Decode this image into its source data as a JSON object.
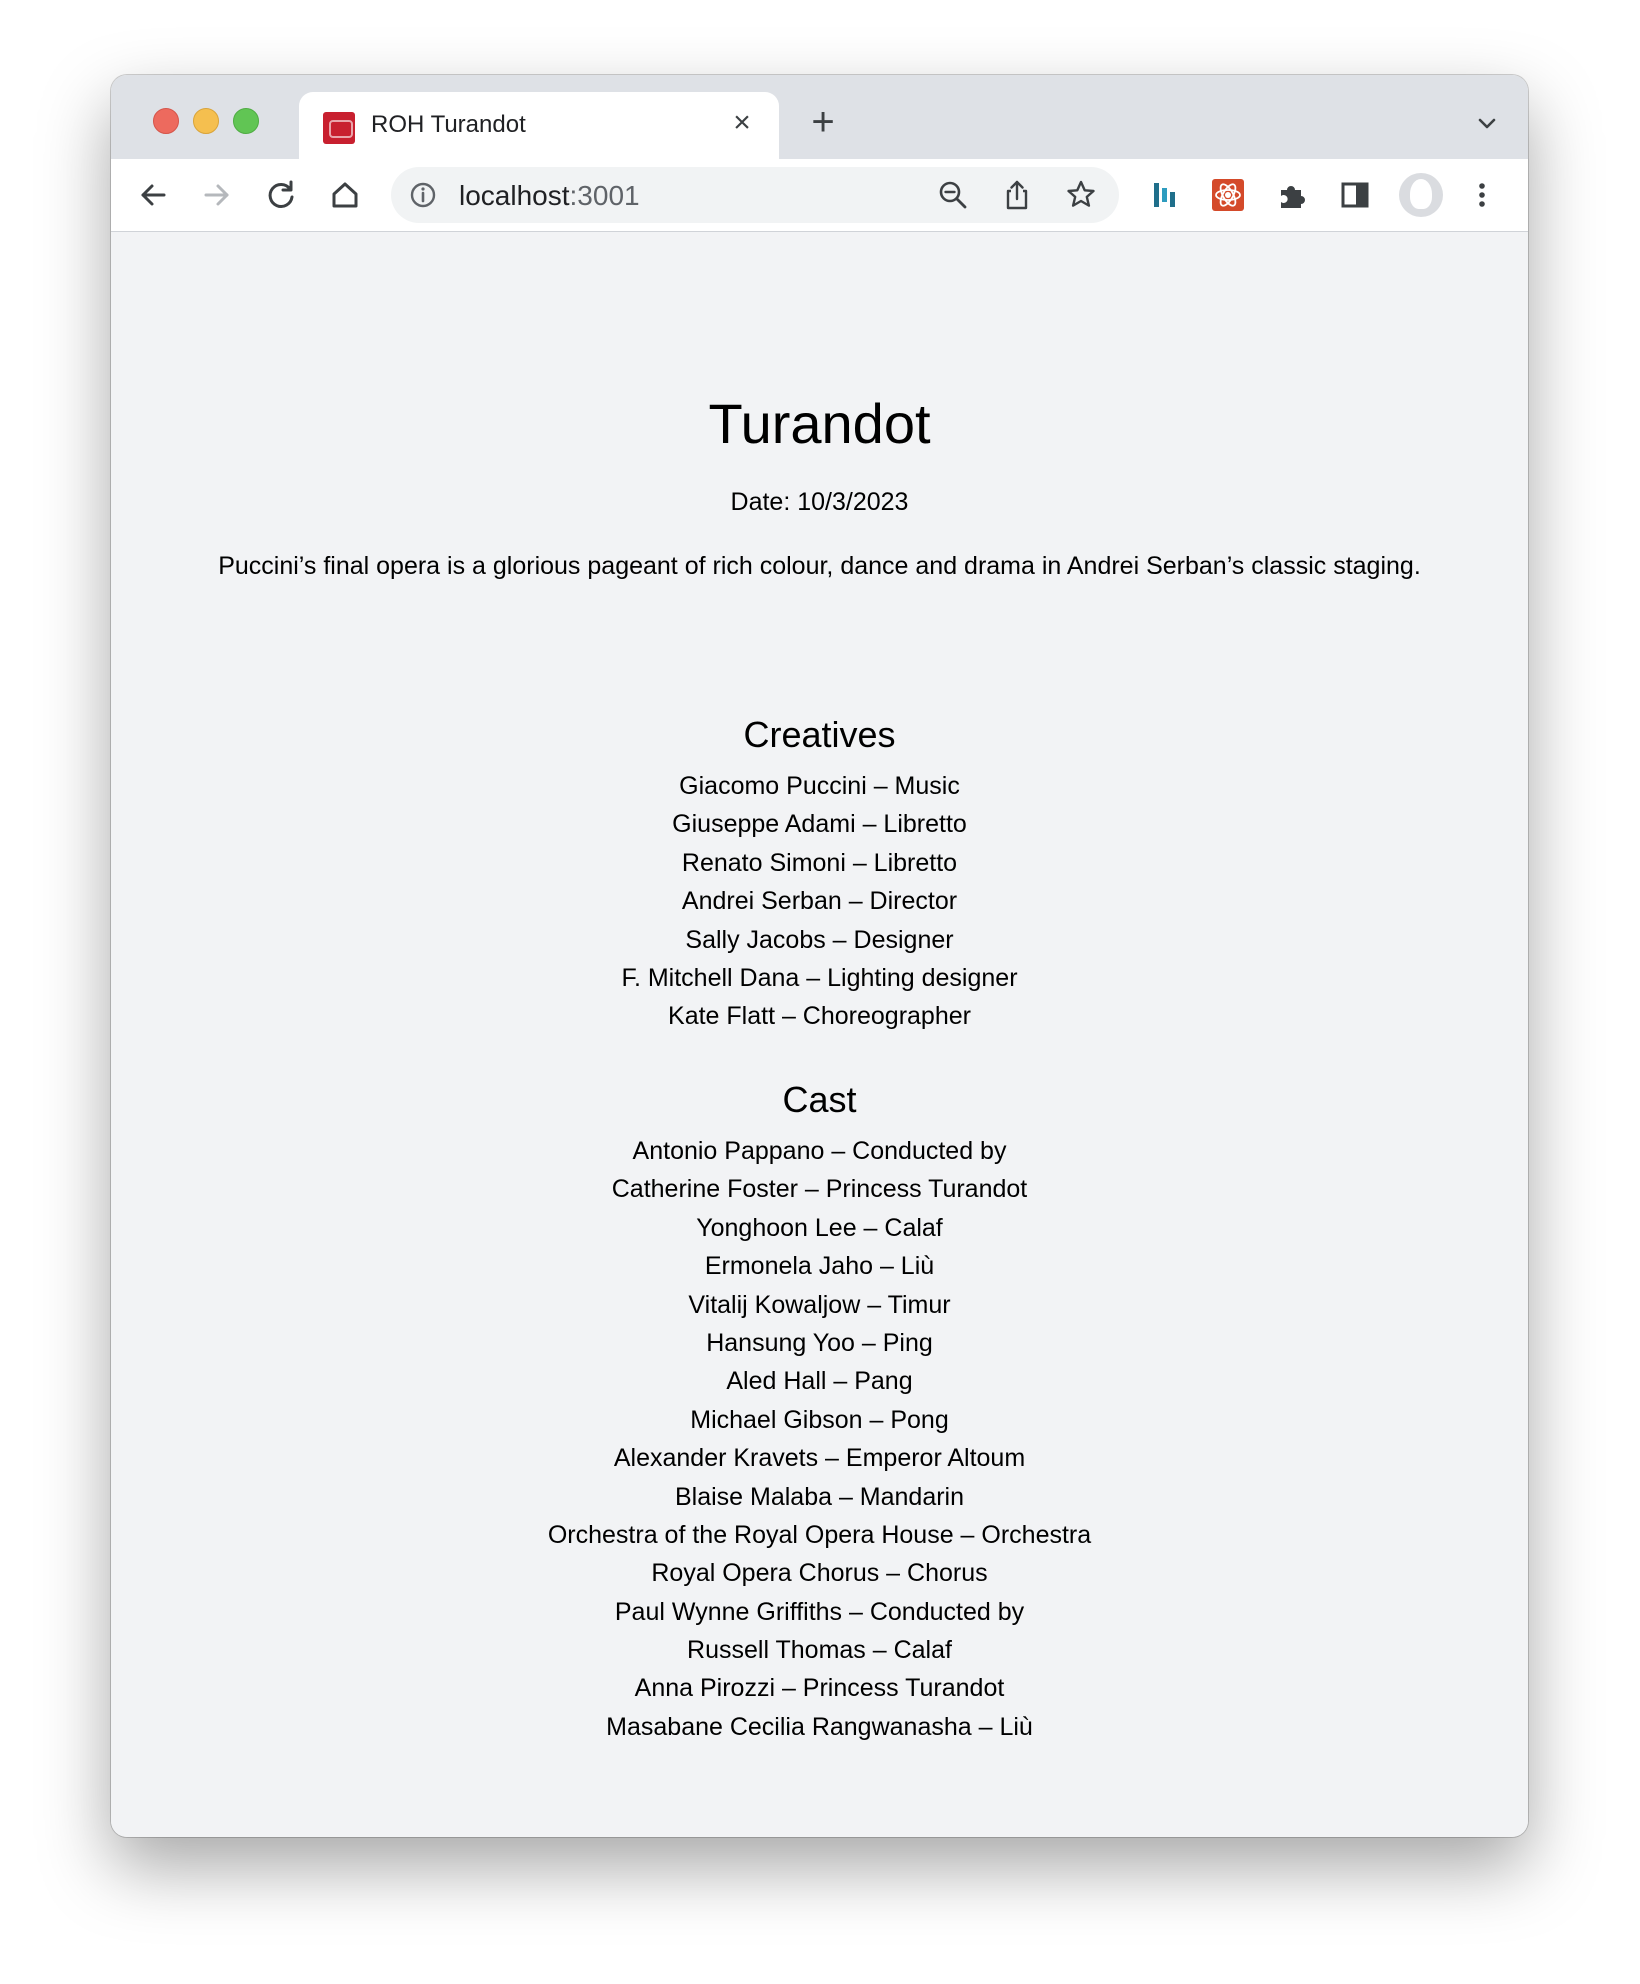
{
  "browser": {
    "tab": {
      "title": "ROH Turandot",
      "favicon": "roh-logo-icon",
      "close_label": "×"
    },
    "new_tab_label": "+",
    "address": {
      "host": "localhost",
      "port": ":3001"
    },
    "colors": {
      "tabstrip": "#dee1e6",
      "toolbar": "#ffffff",
      "page_background": "#f2f3f5",
      "favicon": "#c8202f"
    }
  },
  "page": {
    "title": "Turandot",
    "date_line": "Date: 10/3/2023",
    "description": "Puccini’s final opera is a glorious pageant of rich colour, dance and drama in Andrei Serban’s classic staging.",
    "creatives": {
      "heading": "Creatives",
      "items": [
        "Giacomo Puccini – Music",
        "Giuseppe Adami – Libretto",
        "Renato Simoni – Libretto",
        "Andrei Serban – Director",
        "Sally Jacobs – Designer",
        "F. Mitchell Dana – Lighting designer",
        "Kate Flatt – Choreographer"
      ]
    },
    "cast": {
      "heading": "Cast",
      "items": [
        "Antonio Pappano – Conducted by",
        "Catherine Foster – Princess Turandot",
        "Yonghoon Lee – Calaf",
        "Ermonela Jaho – Liù",
        "Vitalij Kowaljow – Timur",
        "Hansung Yoo – Ping",
        "Aled Hall – Pang",
        "Michael Gibson – Pong",
        "Alexander Kravets – Emperor Altoum",
        "Blaise Malaba – Mandarin",
        "Orchestra of the Royal Opera House – Orchestra",
        "Royal Opera Chorus – Chorus",
        "Paul Wynne Griffiths – Conducted by",
        "Russell Thomas – Calaf",
        "Anna Pirozzi – Princess Turandot",
        "Masabane Cecilia Rangwanasha – Liù"
      ]
    }
  }
}
